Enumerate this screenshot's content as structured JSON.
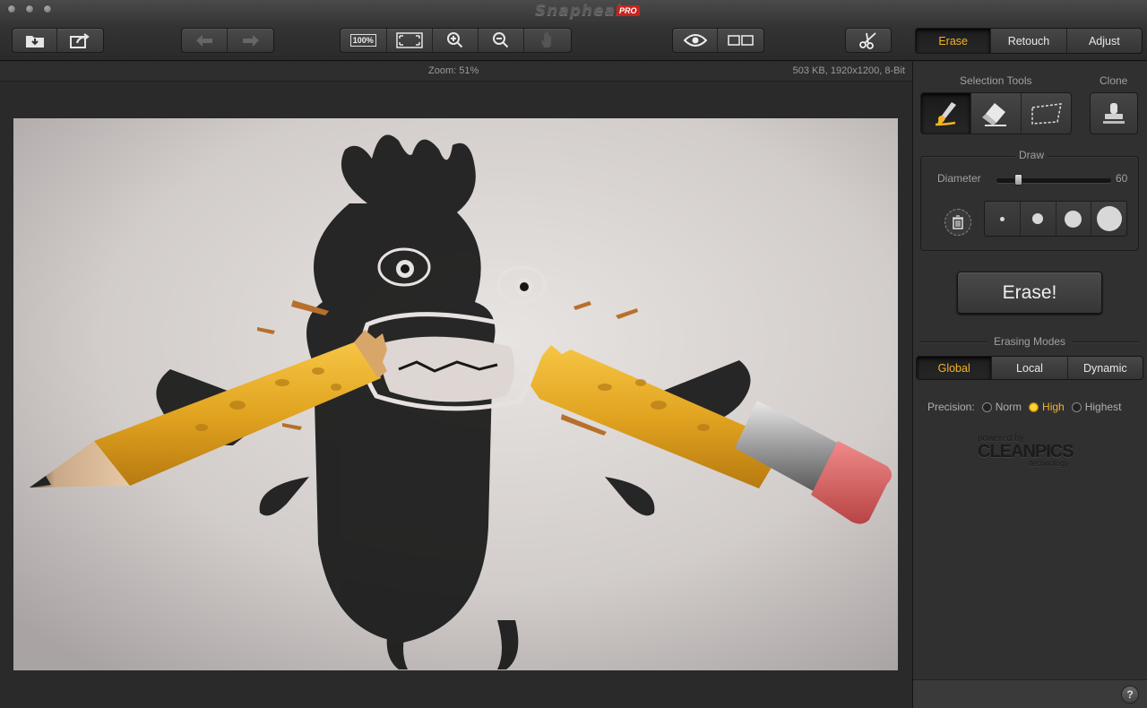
{
  "window": {
    "title": "Snapheal",
    "badge": "PRO"
  },
  "toolbar": {
    "zoom_100_label": "100%",
    "mode_tabs": [
      {
        "label": "Erase",
        "active": true
      },
      {
        "label": "Retouch",
        "active": false
      },
      {
        "label": "Adjust",
        "active": false
      }
    ]
  },
  "infobar": {
    "zoom": "Zoom: 51%",
    "file_info": "503 KB, 1920x1200, 8-Bit"
  },
  "panel": {
    "selection_tools_label": "Selection Tools",
    "clone_label": "Clone",
    "draw_label": "Draw",
    "diameter_label": "Diameter",
    "diameter_value": "60",
    "diameter_fraction": 0.17,
    "erase_button": "Erase!",
    "erasing_modes_label": "Erasing Modes",
    "erasing_modes": [
      {
        "label": "Global",
        "active": true
      },
      {
        "label": "Local",
        "active": false
      },
      {
        "label": "Dynamic",
        "active": false
      }
    ],
    "precision_label": "Precision:",
    "precision_options": [
      {
        "label": "Norm",
        "checked": false
      },
      {
        "label": "High",
        "checked": true
      },
      {
        "label": "Highest",
        "checked": false
      }
    ],
    "powered_by": "powered by",
    "brand": "CLEANPICS",
    "technology": "technology",
    "help": "?"
  },
  "colors": {
    "accent": "#f5b326",
    "panel_bg": "#303030"
  }
}
